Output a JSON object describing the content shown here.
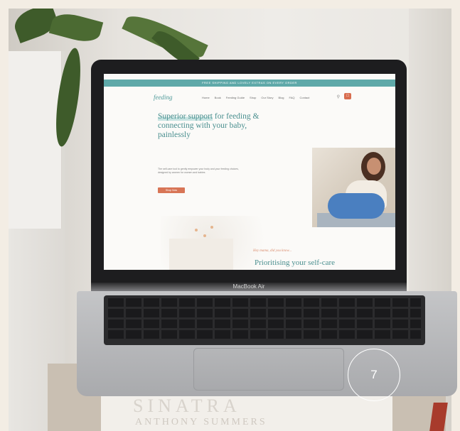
{
  "screen": {
    "banner_text": "FREE SHIPPING AND LOVELY EXTRAS ON EVERY ORDER",
    "logo_text": "feeding",
    "nav_links": [
      "Home",
      "Book",
      "Feeding Guide",
      "Shop",
      "Our Story",
      "Blog",
      "FAQ",
      "Contact"
    ],
    "search_icon": "search-icon",
    "cart_icon": "cart-icon",
    "headline_part1": "Superior support",
    "headline_part2": " for feeding & connecting with your baby, painlessly",
    "subtext": "The self-care tool to gently empower your body and your feeding choices, designed by women for women and babies",
    "cta_label": "Shop Now",
    "script_text": "Hey mama, did you know...",
    "section_title": "Prioritising your self-care"
  },
  "laptop": {
    "model_name": "MacBook Air"
  },
  "books": {
    "title_text": "SINATRA",
    "author_text": "ANTHONY SUMMERS"
  },
  "badge": {
    "number": "7"
  },
  "colors": {
    "accent_teal": "#5fa9a9",
    "cta_orange": "#d87556",
    "background": "#f3ede4"
  }
}
